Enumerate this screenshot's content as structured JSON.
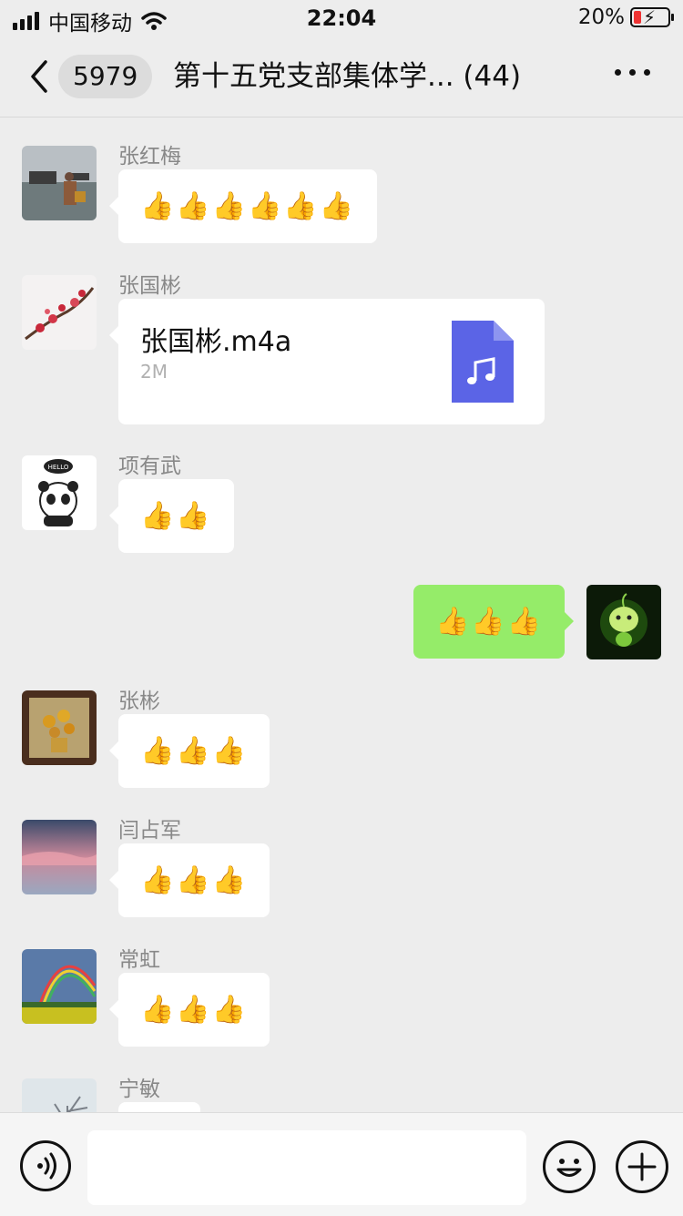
{
  "status_bar": {
    "carrier": "中国移动",
    "time": "22:04",
    "battery": "20%"
  },
  "nav": {
    "unread_count": "5979",
    "title": "第十五党支部集体学... (44)"
  },
  "messages": [
    {
      "sender": "张红梅",
      "content": "👍👍👍👍👍👍"
    },
    {
      "sender": "张国彬",
      "file_name": "张国彬.m4a",
      "file_size": "2M"
    },
    {
      "sender": "项有武",
      "content": "👍👍"
    },
    {
      "sender": "",
      "content": "👍👍👍"
    },
    {
      "sender": "张彬",
      "content": "👍👍👍"
    },
    {
      "sender": "闫占军",
      "content": "👍👍👍"
    },
    {
      "sender": "常虹",
      "content": "👍👍👍"
    },
    {
      "sender": "宁敏",
      "content": ""
    }
  ],
  "input_bar": {
    "placeholder": ""
  },
  "colors": {
    "background": "#ededed",
    "self_bubble": "#95ec69",
    "file_icon": "#5b64e6"
  },
  "icons": [
    "back-chevron-icon",
    "more-dots-icon",
    "music-file-icon",
    "voice-icon",
    "emoji-icon",
    "plus-icon"
  ]
}
